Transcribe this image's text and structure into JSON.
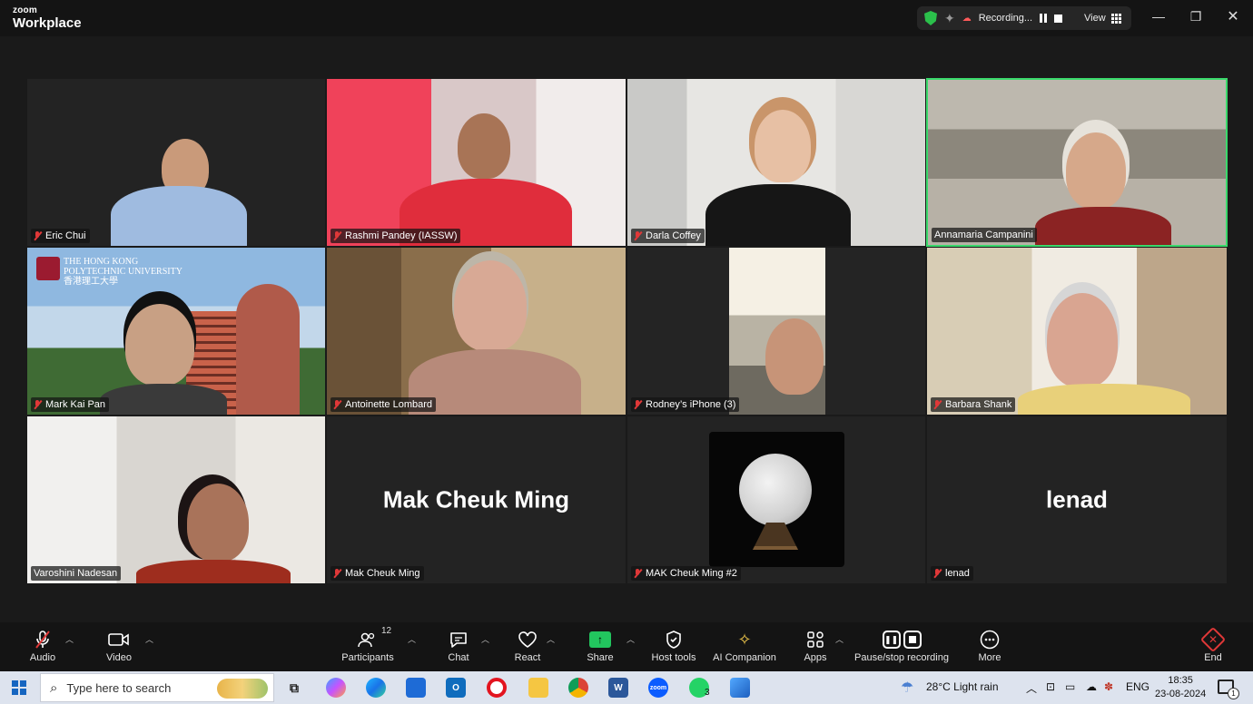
{
  "app": {
    "brand_top": "zoom",
    "brand_bottom": "Workplace"
  },
  "titlebar": {
    "recording_label": "Recording...",
    "view_label": "View"
  },
  "participants": [
    {
      "name": "Eric Chui"
    },
    {
      "name": "Rashmi Pandey (IASSW)"
    },
    {
      "name": "Darla Coffey"
    },
    {
      "name": "Annamaria Campanini"
    },
    {
      "name": "Mark Kai Pan"
    },
    {
      "name": "Antoinette Lombard"
    },
    {
      "name": "Rodney’s iPhone (3)"
    },
    {
      "name": "Barbara Shank"
    },
    {
      "name": "Varoshini Nadesan"
    },
    {
      "name": "Mak Cheuk Ming",
      "display_text": "Mak Cheuk Ming"
    },
    {
      "name": "MAK Cheuk Ming #2"
    },
    {
      "name": "lenad",
      "display_text": "lenad"
    }
  ],
  "background_logo": {
    "line1": "THE HONG KONG",
    "line2": "POLYTECHNIC UNIVERSITY",
    "line3": "香港理工大學"
  },
  "toolbar": {
    "audio": "Audio",
    "video": "Video",
    "participants": "Participants",
    "participants_count": "12",
    "chat": "Chat",
    "react": "React",
    "share": "Share",
    "host_tools": "Host tools",
    "ai_companion": "AI Companion",
    "apps": "Apps",
    "pause_stop": "Pause/stop recording",
    "more": "More",
    "end": "End"
  },
  "taskbar": {
    "search_placeholder": "Type here to search",
    "weather": "28°C  Light rain",
    "lang": "ENG",
    "time": "18:35",
    "date": "23-08-2024",
    "whatsapp_badge": "3",
    "notification_count": "1",
    "zoom_label": "zoom",
    "word_label": "W"
  },
  "colors": {
    "active_speaker": "#3ad96b",
    "share_green": "#22c55e",
    "end_red": "#e03838"
  }
}
